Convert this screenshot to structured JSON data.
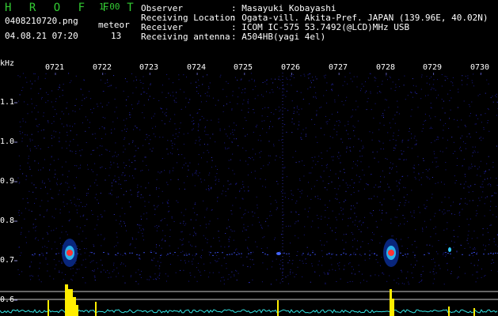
{
  "header": {
    "app_title": "H R O F F T",
    "app_version": "1.00",
    "file_name": "0408210720.png",
    "meteor_label": "meteor",
    "meteor_count": "13",
    "datetime": "04.08.21 07:20"
  },
  "info": [
    {
      "label": "Observer",
      "value": ": Masayuki Kobayashi"
    },
    {
      "label": "Receiving Location",
      "value": ": Ogata-vill. Akita-Pref. JAPAN (139.96E, 40.02N)"
    },
    {
      "label": "Receiver",
      "value": ": ICOM IC-575 53.7492(@LCD)MHz USB"
    },
    {
      "label": "Receiving antenna",
      "value": ": A504HB(yagi 4el)"
    }
  ],
  "spectrogram": {
    "unit_label": "kHz",
    "time_labels": [
      "0721",
      "0722",
      "0723",
      "0724",
      "0725",
      "0726",
      "0727",
      "0728",
      "0729",
      "0730"
    ],
    "freq_labels": [
      "1.1",
      "1.0",
      "0.9",
      "0.8",
      "0.7",
      "0.6"
    ],
    "colors": {
      "background": "#000000",
      "noise": "#1a1a8c",
      "echo_core": "#ff3333",
      "echo_mid": "#33ccff",
      "level_trace": "#ffee00",
      "level_baseline": "#33e0e0",
      "guide_line": "#cccccc"
    }
  }
}
